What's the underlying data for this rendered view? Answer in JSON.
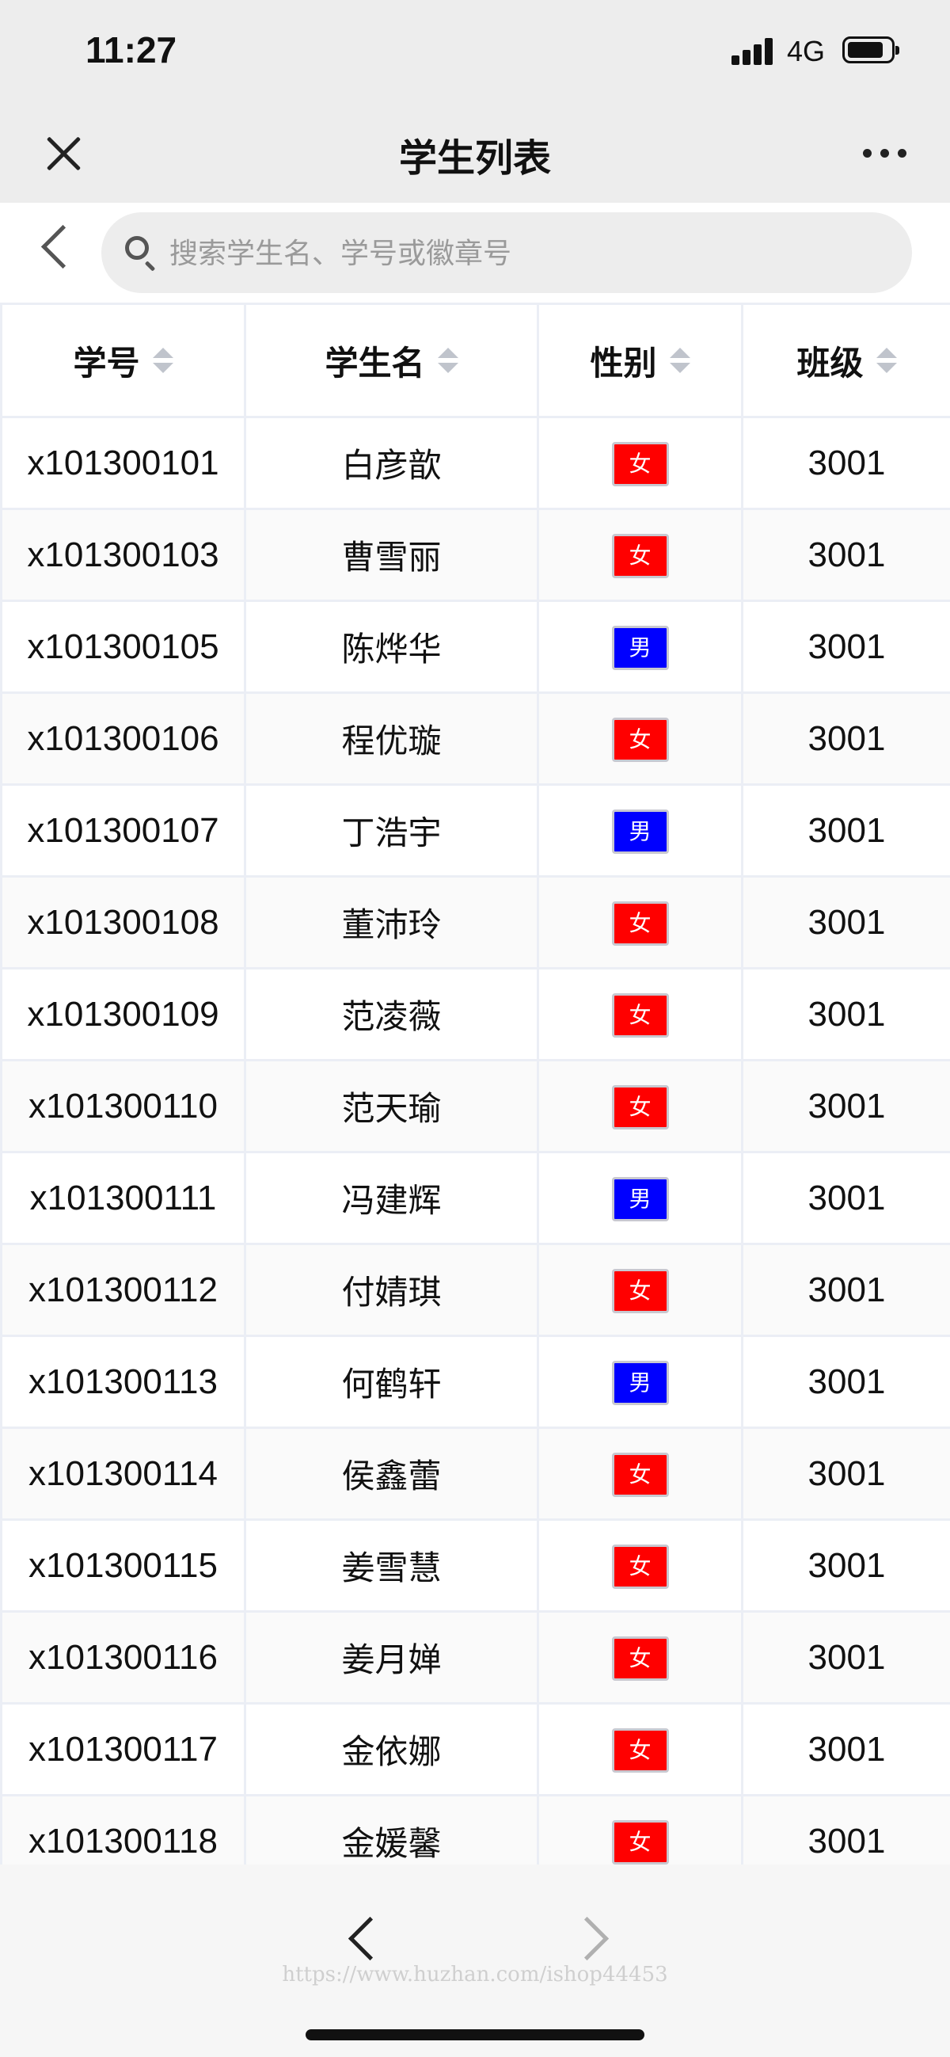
{
  "status_bar": {
    "time": "11:27",
    "network": "4G"
  },
  "title_bar": {
    "title": "学生列表"
  },
  "search": {
    "placeholder": "搜索学生名、学号或徽章号",
    "value": ""
  },
  "table": {
    "columns": [
      {
        "label": "学号"
      },
      {
        "label": "学生名"
      },
      {
        "label": "性别"
      },
      {
        "label": "班级"
      }
    ],
    "gender_colors": {
      "女": "#ff0000",
      "男": "#0000ff"
    },
    "rows": [
      {
        "id": "x101300101",
        "name": "白彦歆",
        "gender": "女",
        "class": "3001"
      },
      {
        "id": "x101300103",
        "name": "曹雪丽",
        "gender": "女",
        "class": "3001"
      },
      {
        "id": "x101300105",
        "name": "陈烨华",
        "gender": "男",
        "class": "3001"
      },
      {
        "id": "x101300106",
        "name": "程优璇",
        "gender": "女",
        "class": "3001"
      },
      {
        "id": "x101300107",
        "name": "丁浩宇",
        "gender": "男",
        "class": "3001"
      },
      {
        "id": "x101300108",
        "name": "董沛玲",
        "gender": "女",
        "class": "3001"
      },
      {
        "id": "x101300109",
        "name": "范凌薇",
        "gender": "女",
        "class": "3001"
      },
      {
        "id": "x101300110",
        "name": "范天瑜",
        "gender": "女",
        "class": "3001"
      },
      {
        "id": "x101300111",
        "name": "冯建辉",
        "gender": "男",
        "class": "3001"
      },
      {
        "id": "x101300112",
        "name": "付婧琪",
        "gender": "女",
        "class": "3001"
      },
      {
        "id": "x101300113",
        "name": "何鹤轩",
        "gender": "男",
        "class": "3001"
      },
      {
        "id": "x101300114",
        "name": "侯鑫蕾",
        "gender": "女",
        "class": "3001"
      },
      {
        "id": "x101300115",
        "name": "姜雪慧",
        "gender": "女",
        "class": "3001"
      },
      {
        "id": "x101300116",
        "name": "姜月婵",
        "gender": "女",
        "class": "3001"
      },
      {
        "id": "x101300117",
        "name": "金依娜",
        "gender": "女",
        "class": "3001"
      },
      {
        "id": "x101300118",
        "name": "金媛馨",
        "gender": "女",
        "class": "3001"
      }
    ]
  },
  "bottom_bar": {
    "watermark": "https://www.huzhan.com/ishop44453"
  }
}
